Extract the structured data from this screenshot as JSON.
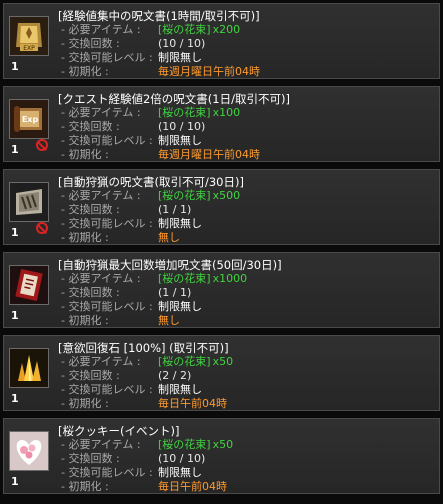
{
  "labels": {
    "required": "- 必要アイテム : ",
    "exchange": "- 交換回数 : ",
    "level": "- 交換可能レベル : ",
    "reset": "- 初期化 : "
  },
  "entries": [
    {
      "title": "[経験値集中の呪文書(1時間/取引不可)]",
      "count": "1",
      "icon": "exp-scroll-gold-icon",
      "banned": false,
      "item": "[桜の花束]",
      "qty": "x200",
      "exchange": "(10 / 10)",
      "level": "制限無し",
      "reset": "毎週月曜日午前04時"
    },
    {
      "title": "[クエスト経験値2倍の呪文書(1日/取引不可)]",
      "count": "1",
      "icon": "exp-scroll-red-icon",
      "banned": true,
      "item": "[桜の花束]",
      "qty": "x100",
      "exchange": "(10 / 10)",
      "level": "制限無し",
      "reset": "毎週月曜日午前04時"
    },
    {
      "title": "[自動狩猟の呪文書(取引不可/30日)]",
      "count": "1",
      "icon": "auto-hunt-scroll-icon",
      "banned": true,
      "item": "[桜の花束]",
      "qty": "x500",
      "exchange": "(1 / 1)",
      "level": "制限無し",
      "reset": "無し"
    },
    {
      "title": "[自動狩猟最大回数増加呪文書(50回/30日)]",
      "count": "1",
      "icon": "auto-hunt-max-scroll-icon",
      "banned": false,
      "item": "[桜の花束]",
      "qty": "x1000",
      "exchange": "(1 / 1)",
      "level": "制限無し",
      "reset": "無し"
    },
    {
      "title": "[意欲回復石 [100%] (取引不可)]",
      "count": "1",
      "icon": "gold-crystal-icon",
      "banned": false,
      "item": "[桜の花束]",
      "qty": "x50",
      "exchange": "(2 / 2)",
      "level": "制限無し",
      "reset": "毎日午前04時"
    },
    {
      "title": "[桜クッキー(イベント)]",
      "count": "1",
      "icon": "sakura-cookie-icon",
      "banned": false,
      "item": "[桜の花束]",
      "qty": "x50",
      "exchange": "(10 / 10)",
      "level": "制限無し",
      "reset": "毎日午前04時"
    }
  ]
}
